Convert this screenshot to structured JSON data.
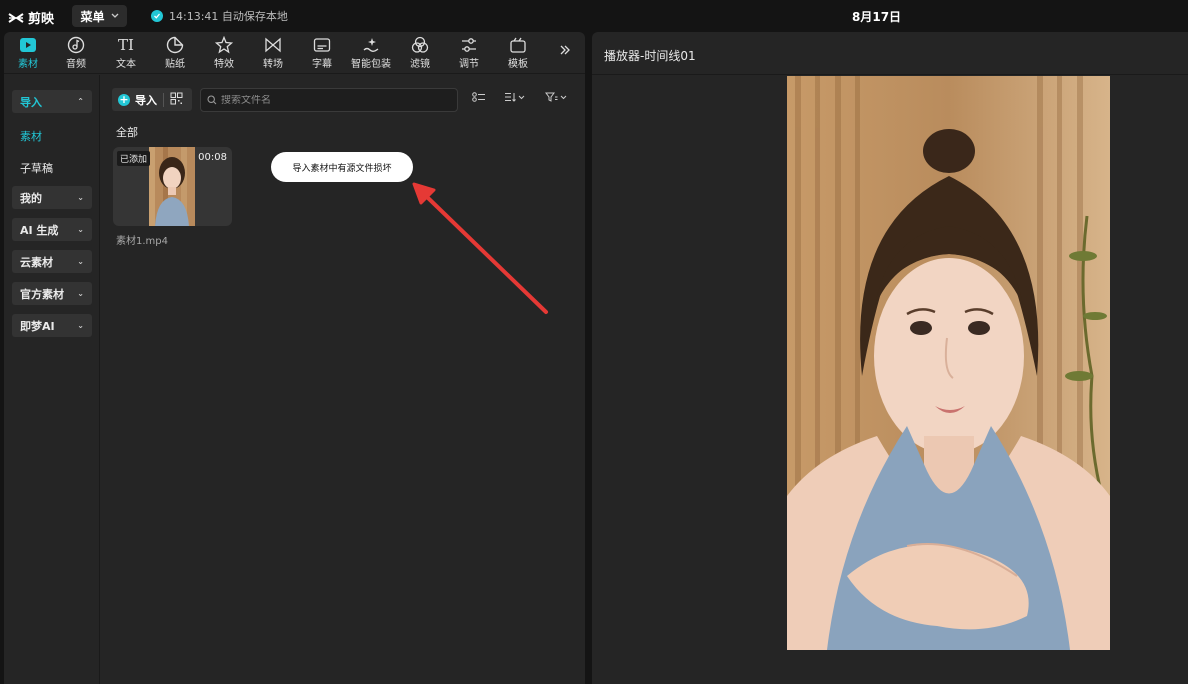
{
  "app": {
    "name": "剪映",
    "menu_label": "菜单",
    "save_status": "14:13:41 自动保存本地",
    "date": "8月17日"
  },
  "toolbar": {
    "tools": [
      {
        "label": "素材",
        "icon": "media-icon",
        "active": true
      },
      {
        "label": "音频",
        "icon": "audio-icon"
      },
      {
        "label": "文本",
        "icon": "text-icon"
      },
      {
        "label": "贴纸",
        "icon": "sticker-icon"
      },
      {
        "label": "特效",
        "icon": "effects-icon"
      },
      {
        "label": "转场",
        "icon": "transition-icon"
      },
      {
        "label": "字幕",
        "icon": "subtitle-icon"
      },
      {
        "label": "智能包装",
        "icon": "smart-package-icon"
      },
      {
        "label": "滤镜",
        "icon": "filter-icon"
      },
      {
        "label": "调节",
        "icon": "adjust-icon"
      },
      {
        "label": "模板",
        "icon": "template-icon"
      }
    ],
    "more_icon": "double-chevron-right-icon"
  },
  "sidebar": {
    "import": "导入",
    "material": "素材",
    "subdraft": "子草稿",
    "mine": "我的",
    "ai_generate": "AI 生成",
    "cloud": "云素材",
    "official": "官方素材",
    "jimeng": "即梦AI"
  },
  "media": {
    "import_label": "导入",
    "search_placeholder": "搜索文件名",
    "all_label": "全部",
    "clip": {
      "badge": "已添加",
      "duration": "00:08",
      "file_name": "素材1.mp4"
    },
    "callout": "导入素材中有源文件损坏"
  },
  "player": {
    "title": "播放器-时间线01"
  },
  "colors": {
    "accent": "#22c7d6",
    "annotation_arrow": "#e53935"
  }
}
